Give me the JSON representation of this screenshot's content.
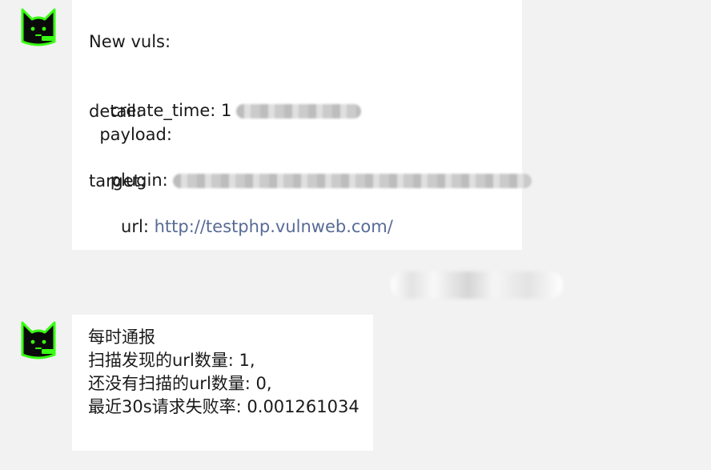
{
  "messages": [
    {
      "avatar_icon": "black-cat-neon-green-icon",
      "title": "New vuls:",
      "lines": {
        "create_time": "create_time: 1",
        "detail": "detail:",
        "payload": "  payload:",
        "plugin": "plugin:",
        "target": "target:",
        "url_label": "  url: ",
        "url_value": "http://testphp.vulnweb.com/"
      }
    },
    {
      "avatar_icon": "black-cat-neon-green-icon",
      "lines": {
        "l1": "每时通报",
        "l2": "扫描发现的url数量: 1,",
        "l3": "还没有扫描的url数量: 0,",
        "l4": "最近30s请求失败率: 0.001261034"
      }
    }
  ],
  "colors": {
    "chat_bg": "#f2f2f2",
    "bubble_bg": "#ffffff",
    "link": "#576b95",
    "avatar_accent": "#39ff14"
  }
}
